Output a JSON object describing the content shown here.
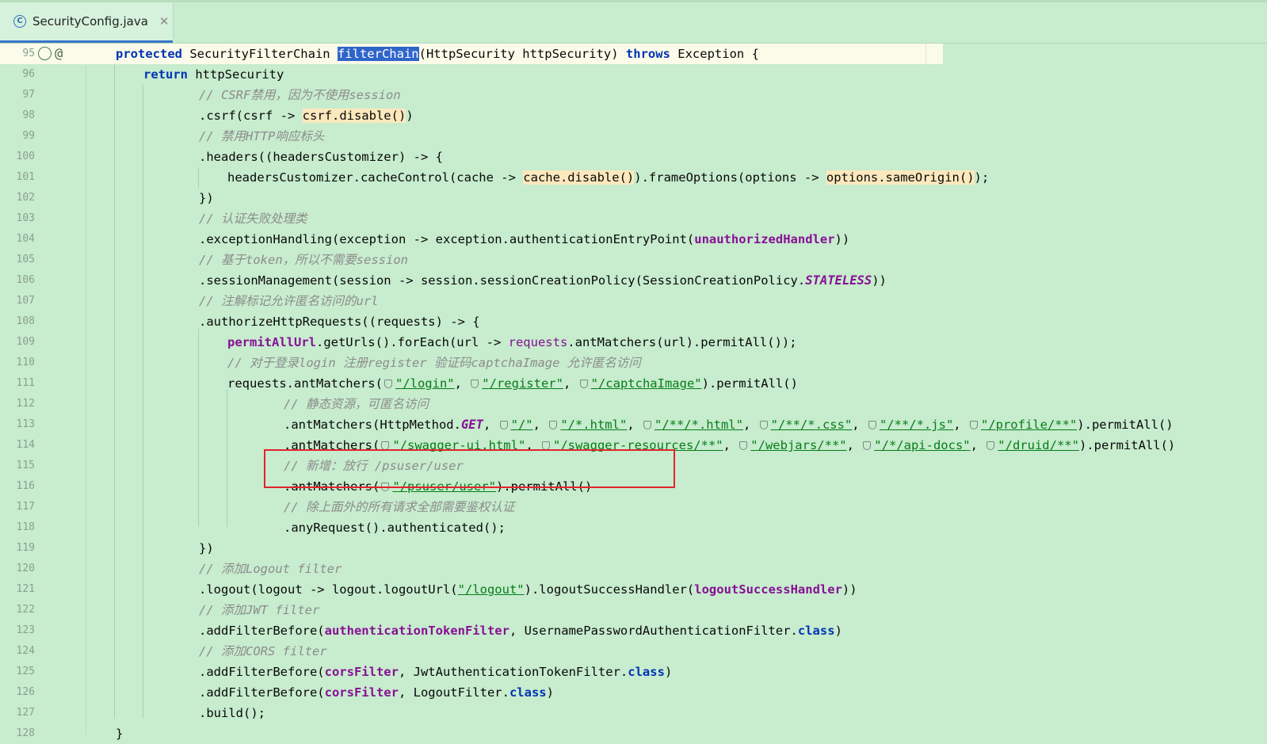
{
  "tab": {
    "title": "SecurityConfig.java",
    "close_icon": "close-icon",
    "file_icon": "java-class-icon"
  },
  "lines": [
    {
      "n": "95"
    },
    {
      "n": "96"
    },
    {
      "n": "97"
    },
    {
      "n": "98"
    },
    {
      "n": "99"
    },
    {
      "n": "100"
    },
    {
      "n": "101"
    },
    {
      "n": "102"
    },
    {
      "n": "103"
    },
    {
      "n": "104"
    },
    {
      "n": "105"
    },
    {
      "n": "106"
    },
    {
      "n": "107"
    },
    {
      "n": "108"
    },
    {
      "n": "109"
    },
    {
      "n": "110"
    },
    {
      "n": "111"
    },
    {
      "n": "112"
    },
    {
      "n": "113"
    },
    {
      "n": "114"
    },
    {
      "n": "115"
    },
    {
      "n": "116"
    },
    {
      "n": "117"
    },
    {
      "n": "118"
    },
    {
      "n": "119"
    },
    {
      "n": "120"
    },
    {
      "n": "121"
    },
    {
      "n": "122"
    },
    {
      "n": "123"
    },
    {
      "n": "124"
    },
    {
      "n": "125"
    },
    {
      "n": "126"
    },
    {
      "n": "127"
    },
    {
      "n": "128"
    }
  ],
  "tokens": {
    "protected": "protected",
    "sfc": " SecurityFilterChain ",
    "filterChain": "filterChain",
    "params": "(HttpSecurity httpSecurity) ",
    "throws": "throws",
    "exc": " Exception {",
    "return": "return",
    "httpSecurity": " httpSecurity",
    "c97": "// CSRF禁用，因为不使用session",
    "l98a": ".csrf(csrf -> ",
    "l98b": "csrf.disable()",
    "l98c": ")",
    "c99": "// 禁用HTTP响应标头",
    "l100": ".headers((headersCustomizer) -> {",
    "l101a": "headersCustomizer.cacheControl(cache -> ",
    "l101b": "cache.disable()",
    "l101c": ").frameOptions(options -> ",
    "l101d": "options.sameOrigin()",
    "l101e": ");",
    "l102": "})",
    "c103": "// 认证失败处理类",
    "l104a": ".exceptionHandling(exception -> exception.authenticationEntryPoint(",
    "l104b": "unauthorizedHandler",
    "l104c": "))",
    "c105": "// 基于token，所以不需要session",
    "l106a": ".sessionManagement(session -> session.sessionCreationPolicy(SessionCreationPolicy.",
    "l106b": "STATELESS",
    "l106c": "))",
    "c107": "// 注解标记允许匿名访问的url",
    "l108": ".authorizeHttpRequests((requests) -> {",
    "l109a": "permitAllUrl",
    "l109b": ".getUrls().forEach(url -> ",
    "l109c": "requests",
    "l109d": ".antMatchers(url).permitAll());",
    "c110": "// 对于登录login 注册register 验证码captchaImage 允许匿名访问",
    "l111a": "requests.antMatchers(",
    "s_login": "\"/login\"",
    "s_register": "\"/register\"",
    "s_captcha": "\"/captchaImage\"",
    "permitAllEnd": ").permitAll()",
    "c112": "// 静态资源，可匿名访问",
    "l113a": ".antMatchers(HttpMethod.",
    "GET": "GET",
    "s_root": "\"/\"",
    "s_html": "\"/*.html\"",
    "s_html2": "\"/**/*.html\"",
    "s_css": "\"/**/*.css\"",
    "s_js": "\"/**/*.js\"",
    "s_profile": "\"/profile/**\"",
    "l114a": ".antMatchers(",
    "s_swagger": "\"/swagger-ui.html\"",
    "s_swres": "\"/swagger-resources/**\"",
    "s_webjars": "\"/webjars/**\"",
    "s_apidocs": "\"/*/api-docs\"",
    "s_druid": "\"/druid/**\"",
    "c115": "// 新增：放行 /psuser/user",
    "s_psuser": "\"/psuser/user\"",
    "c117": "// 除上面外的所有请求全部需要鉴权认证",
    "l118": ".anyRequest().authenticated();",
    "l119": "})",
    "c120": "// 添加Logout filter",
    "l121a": ".logout(logout -> logout.logoutUrl(",
    "s_logout": "\"/logout\"",
    "l121b": ").logoutSuccessHandler(",
    "l121c": "logoutSuccessHandler",
    "l121d": "))",
    "c122": "// 添加JWT filter",
    "l123a": ".addFilterBefore(",
    "l123b": "authenticationTokenFilter",
    "l123c": ", UsernamePasswordAuthenticationFilter.",
    "class": "class",
    "l123d": ")",
    "c124": "// 添加CORS filter",
    "l125a": ".addFilterBefore(",
    "corsFilter": "corsFilter",
    "l125b": ", JwtAuthenticationTokenFilter.",
    "l126b": ", LogoutFilter.",
    "l127": ".build();",
    "l128": "}",
    "comma": ", "
  }
}
